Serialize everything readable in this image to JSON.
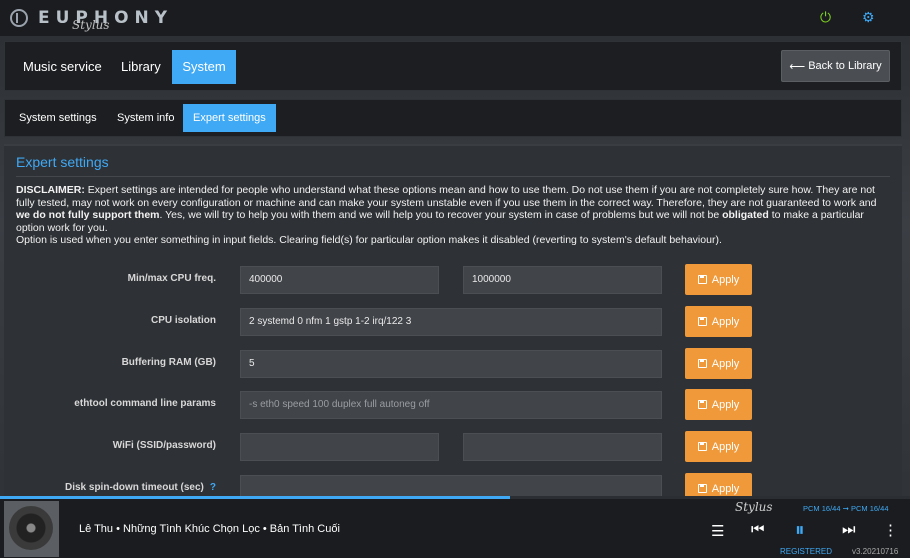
{
  "header": {
    "logo_text": "EUPHONY",
    "logo_sub": "Stylus",
    "icons": [
      "power-icon",
      "gear-icon"
    ]
  },
  "nav": {
    "tabs": [
      "Music service",
      "Library",
      "System"
    ],
    "active": "System",
    "back_label": "Back to Library"
  },
  "subnav": {
    "tabs": [
      "System settings",
      "System info",
      "Expert settings"
    ],
    "active": "Expert settings"
  },
  "panel": {
    "title": "Expert settings",
    "disclaimer_label": "DISCLAIMER:",
    "disclaimer_1": " Expert settings are intended for people who understand what these options mean and how to use them. Do not use them if you are not completely sure how. They are not fully tested, may not work on every configuration or machine and can make your system unstable even if you use them in the correct way. Therefore, they are not guaranteed to work and ",
    "disclaimer_bold_1": "we do not fully support them",
    "disclaimer_2": ". Yes, we will try to help you with them and we will help you to recover your system in case of problems but we will not be ",
    "disclaimer_bold_2": "obligated",
    "disclaimer_3": " to make a particular option work for you.",
    "disclaimer_4": "Option is used when you enter something in input fields. Clearing field(s) for particular option makes it disabled (reverting to system's default behaviour).",
    "apply_label": "Apply",
    "rows": [
      {
        "label": "Min/max CPU freq.",
        "value1": "400000",
        "value2": "1000000"
      },
      {
        "label": "CPU isolation",
        "value1": "2 systemd 0 nfm 1 gstp 1-2 irq/122 3"
      },
      {
        "label": "Buffering RAM (GB)",
        "value1": "5"
      },
      {
        "label": "ethtool command line params",
        "placeholder": "-s eth0 speed 100 duplex full autoneg off"
      },
      {
        "label": "WiFi (SSID/password)",
        "value1": "",
        "value2": ""
      },
      {
        "label": "Disk spin-down timeout (sec)",
        "help": "?",
        "value1": ""
      }
    ]
  },
  "player": {
    "track": "Lê Thu • Những Tình Khúc Chọn Lọc • Bản Tình Cuối",
    "stylus": "Stylus",
    "format": "PCM 16/44 ➞ PCM 16/44",
    "registered": "REGISTERED",
    "version": "v3.20210716",
    "progress": 0.56,
    "icons": [
      "queue-icon",
      "previous-icon",
      "pause-icon",
      "next-icon",
      "more-icon"
    ]
  },
  "colors": {
    "accent": "#3fa9f5",
    "apply": "#f0993a",
    "power": "#7ed321"
  }
}
